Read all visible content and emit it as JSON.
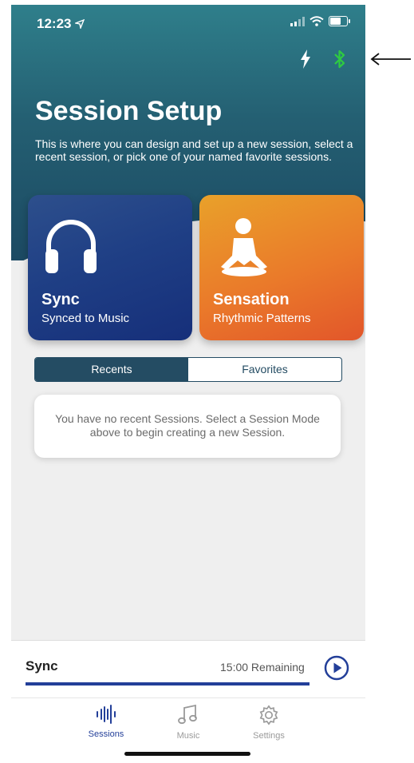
{
  "status": {
    "time": "12:23",
    "location_icon": "location-arrow-icon"
  },
  "header": {
    "title": "Session Setup",
    "subtitle": "This is where you can design and set up a new session, select a recent session, or pick one of your named favorite sessions.",
    "icons": [
      "bolt-icon",
      "bluetooth-icon"
    ],
    "bluetooth_color": "#2ecc40"
  },
  "cards": [
    {
      "title": "Sync",
      "subtitle": "Synced to Music",
      "icon": "headphones-icon"
    },
    {
      "title": "Sensation",
      "subtitle": "Rhythmic Patterns",
      "icon": "meditation-icon"
    }
  ],
  "tabs": {
    "recents": "Recents",
    "favorites": "Favorites",
    "active": "Recents"
  },
  "empty_message": "You have no recent Sessions. Select a Session Mode above to begin creating a new Session.",
  "player": {
    "title": "Sync",
    "remaining": "15:00 Remaining",
    "progress": 1.0
  },
  "tabbar": [
    {
      "label": "Sessions",
      "icon": "waveform-icon",
      "active": true
    },
    {
      "label": "Music",
      "icon": "music-note-icon",
      "active": false
    },
    {
      "label": "Settings",
      "icon": "gear-icon",
      "active": false
    }
  ],
  "colors": {
    "accent": "#233f99",
    "header": "#244c63"
  }
}
